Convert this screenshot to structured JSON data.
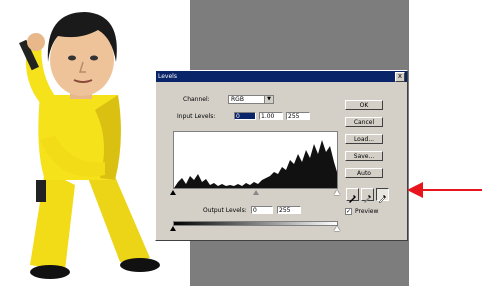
{
  "dialog": {
    "title": "Levels",
    "close_glyph": "x",
    "channel_label": "Channel:",
    "channel_value": "RGB",
    "input_levels_label": "Input Levels:",
    "input_levels": [
      "0",
      "1.00",
      "255"
    ],
    "output_levels_label": "Output Levels:",
    "output_levels": [
      "0",
      "255"
    ],
    "buttons": {
      "ok": "OK",
      "cancel": "Cancel",
      "load": "Load...",
      "save": "Save...",
      "auto": "Auto"
    },
    "eyedroppers": [
      "black-point-eyedropper-icon",
      "gray-point-eyedropper-icon",
      "white-point-eyedropper-icon"
    ],
    "active_eyedropper": "white-point-eyedropper-icon",
    "preview_label": "Preview",
    "preview_checked": true,
    "check_glyph": "✓"
  },
  "annotation": {
    "arrow_color": "#e8141e"
  },
  "colors": {
    "titlebar": "#0a246a",
    "dialog_bg": "#d4d0c8",
    "desktop": "#7d7d7d",
    "figure_yellow": "#f5e21b"
  }
}
